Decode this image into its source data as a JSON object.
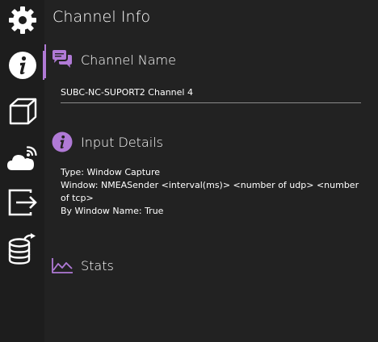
{
  "page": {
    "title": "Channel Info"
  },
  "sidebar": {
    "items": [
      {
        "name": "settings",
        "icon": "gear-icon"
      },
      {
        "name": "info",
        "icon": "info-circle-icon",
        "active": true
      },
      {
        "name": "3d",
        "icon": "cube-icon"
      },
      {
        "name": "cloud",
        "icon": "cloud-signal-icon"
      },
      {
        "name": "export",
        "icon": "export-arrow-icon"
      },
      {
        "name": "database",
        "icon": "database-sync-icon"
      }
    ]
  },
  "sections": {
    "channel_name": {
      "heading": "Channel Name",
      "icon": "chat-bubbles-icon",
      "value": "SUBC-NC-SUPORT2 Channel 4"
    },
    "input_details": {
      "heading": "Input Details",
      "icon": "info-circle-icon",
      "lines": [
        "Type: Window Capture",
        "Window: NMEASender <interval(ms)> <number of udp> <number of tcp>",
        "By Window Name: True"
      ]
    },
    "stats": {
      "heading": "Stats",
      "icon": "line-chart-icon"
    }
  },
  "colors": {
    "accent": "#b07ad6",
    "background": "#222222",
    "rail": "#1d1d1d",
    "text": "#ffffff"
  }
}
